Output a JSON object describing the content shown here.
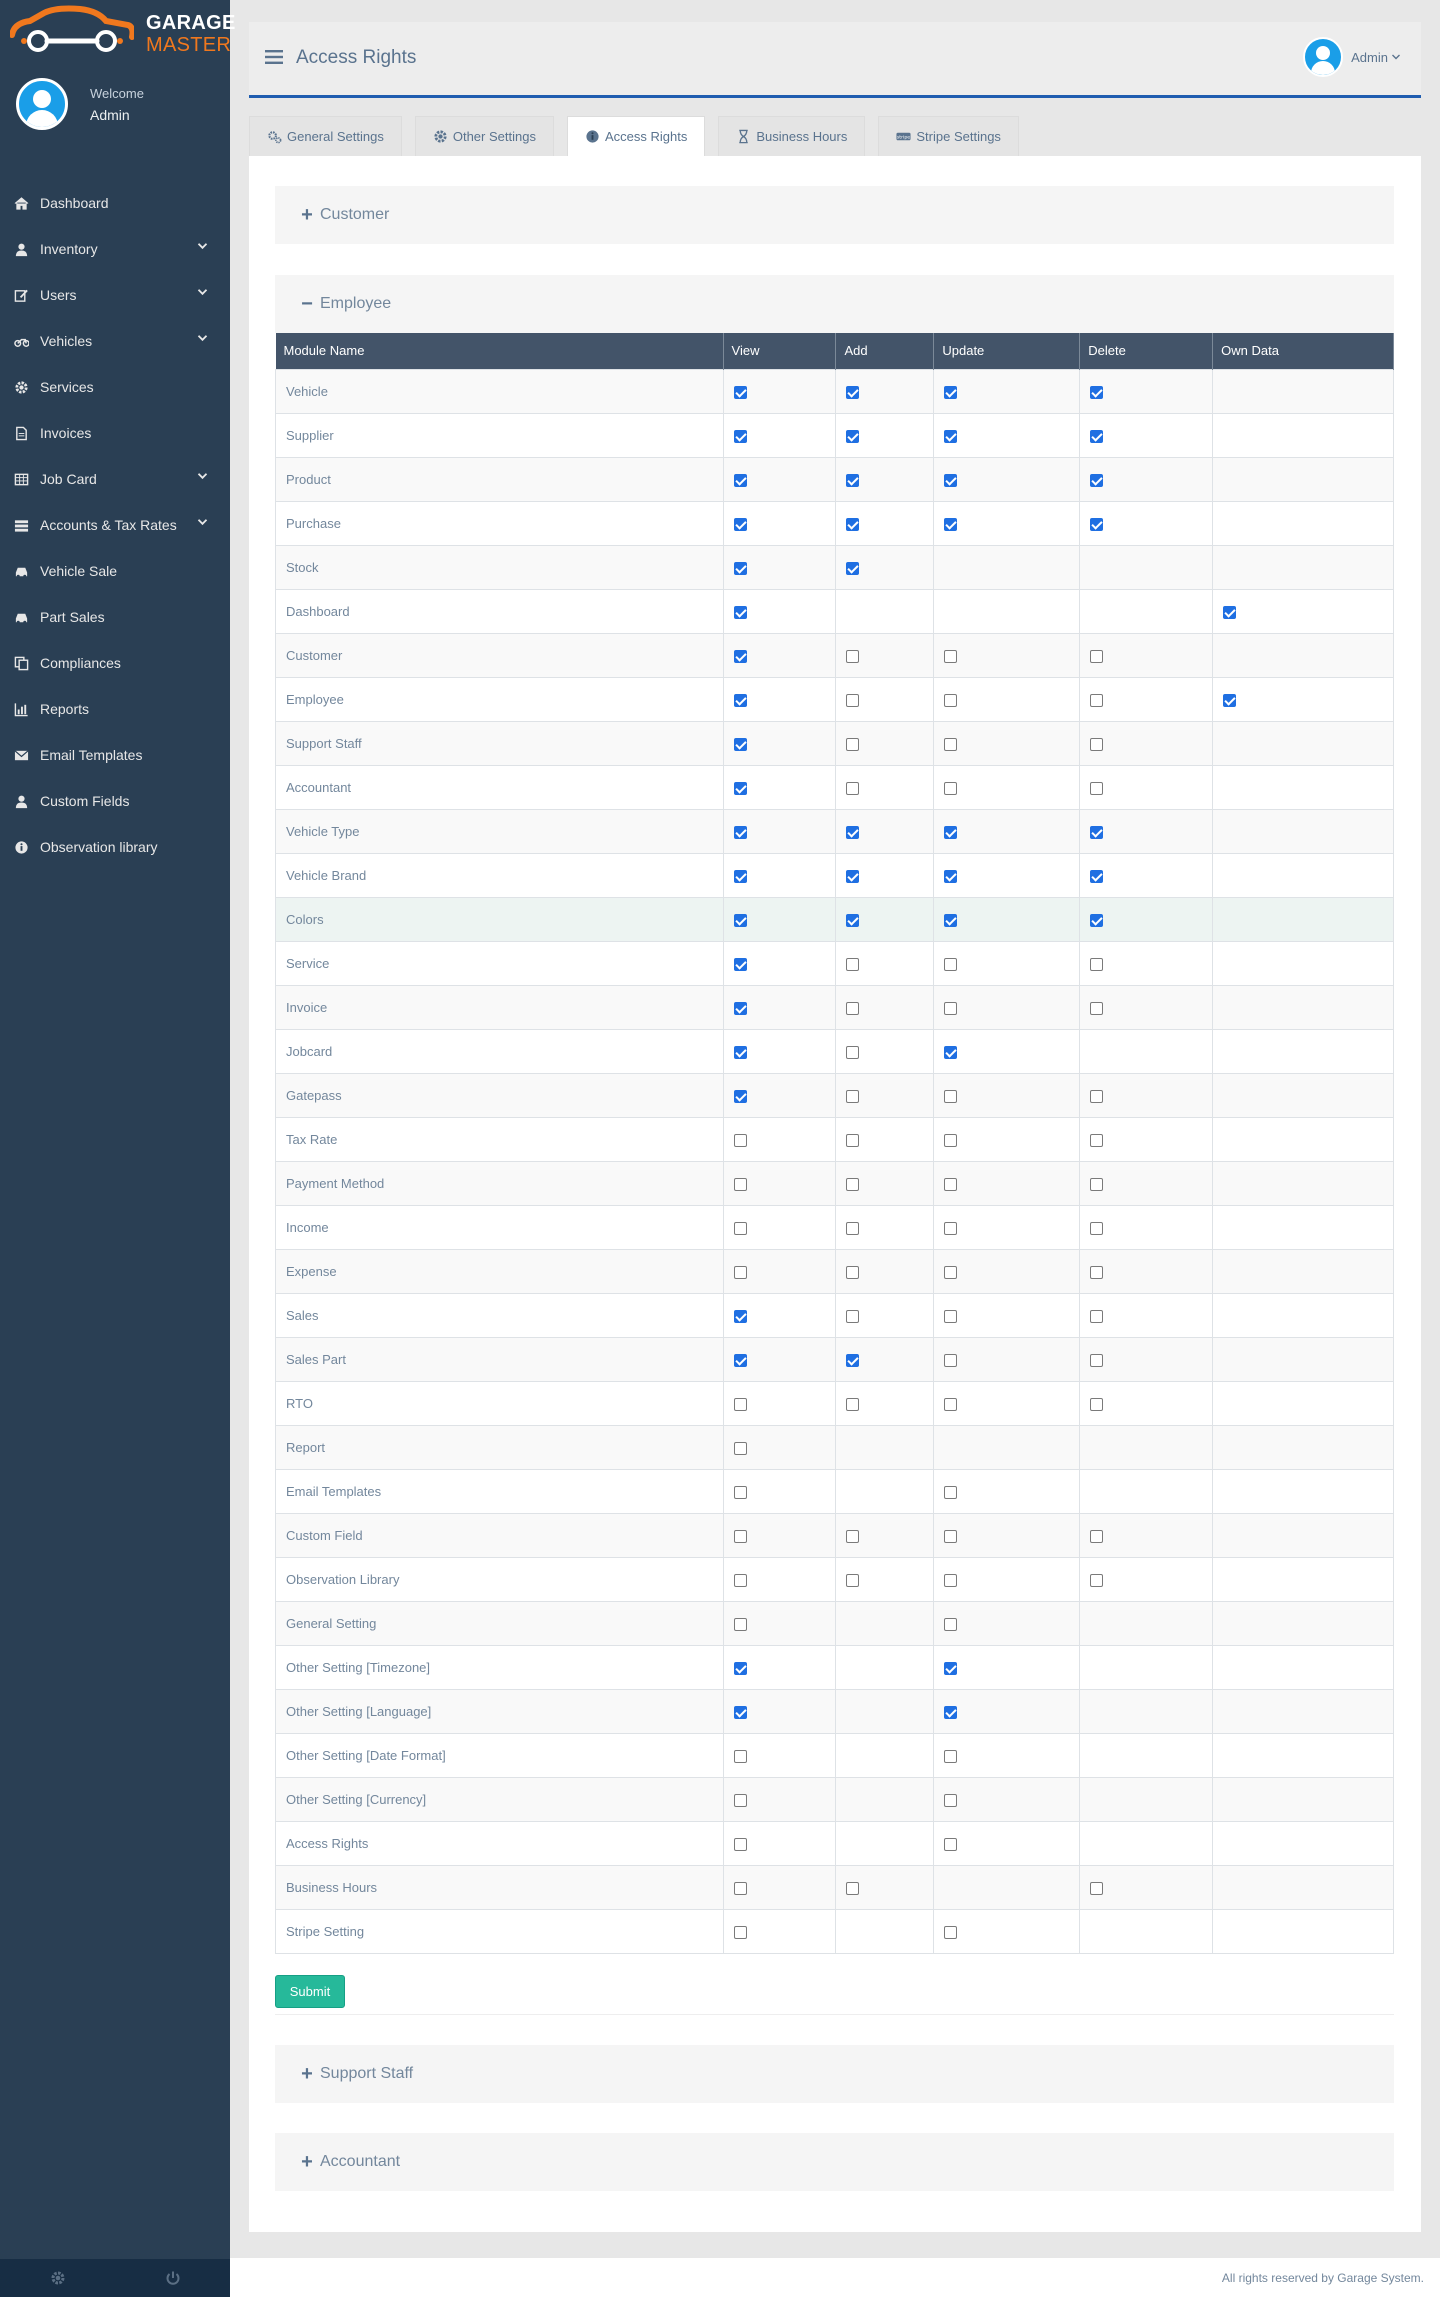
{
  "brand": {
    "line1": "GARAGE",
    "line2": "MASTER"
  },
  "profile": {
    "welcome": "Welcome",
    "name": "Admin"
  },
  "sidebar": {
    "items": [
      {
        "label": "Dashboard",
        "icon": "home-icon",
        "dropdown": false
      },
      {
        "label": "Inventory",
        "icon": "user-icon",
        "dropdown": true
      },
      {
        "label": "Users",
        "icon": "edit-icon",
        "dropdown": true
      },
      {
        "label": "Vehicles",
        "icon": "motorcycle-icon",
        "dropdown": true
      },
      {
        "label": "Services",
        "icon": "gear-icon",
        "dropdown": false
      },
      {
        "label": "Invoices",
        "icon": "file-icon",
        "dropdown": false
      },
      {
        "label": "Job Card",
        "icon": "table-icon",
        "dropdown": true
      },
      {
        "label": "Accounts & Tax Rates",
        "icon": "accounts-icon",
        "dropdown": true
      },
      {
        "label": "Vehicle Sale",
        "icon": "car-icon",
        "dropdown": false
      },
      {
        "label": "Part Sales",
        "icon": "car-icon",
        "dropdown": false
      },
      {
        "label": "Compliances",
        "icon": "copy-icon",
        "dropdown": false
      },
      {
        "label": "Reports",
        "icon": "bar-chart-icon",
        "dropdown": false
      },
      {
        "label": "Email Templates",
        "icon": "envelope-icon",
        "dropdown": false
      },
      {
        "label": "Custom Fields",
        "icon": "user-icon",
        "dropdown": false
      },
      {
        "label": "Observation library",
        "icon": "info-icon",
        "dropdown": false
      }
    ]
  },
  "header": {
    "title": "Access Rights",
    "user": "Admin"
  },
  "tabs": [
    {
      "label": "General Settings",
      "icon": "cogs-icon",
      "active": false
    },
    {
      "label": "Other Settings",
      "icon": "gear-icon",
      "active": false
    },
    {
      "label": "Access Rights",
      "icon": "info-icon",
      "active": true
    },
    {
      "label": "Business Hours",
      "icon": "hourglass-icon",
      "active": false
    },
    {
      "label": "Stripe Settings",
      "icon": "stripe-icon",
      "active": false
    }
  ],
  "sections": {
    "customer": "Customer",
    "employee": "Employee",
    "support_staff": "Support Staff",
    "accountant": "Accountant"
  },
  "table": {
    "columns": [
      "Module Name",
      "View",
      "Add",
      "Update",
      "Delete",
      "Own Data"
    ],
    "rows": [
      {
        "name": "Vehicle",
        "cells": [
          1,
          1,
          1,
          1,
          null
        ]
      },
      {
        "name": "Supplier",
        "cells": [
          1,
          1,
          1,
          1,
          null
        ]
      },
      {
        "name": "Product",
        "cells": [
          1,
          1,
          1,
          1,
          null
        ]
      },
      {
        "name": "Purchase",
        "cells": [
          1,
          1,
          1,
          1,
          null
        ]
      },
      {
        "name": "Stock",
        "cells": [
          1,
          1,
          null,
          null,
          null
        ]
      },
      {
        "name": "Dashboard",
        "cells": [
          1,
          null,
          null,
          null,
          1
        ]
      },
      {
        "name": "Customer",
        "cells": [
          1,
          0,
          0,
          0,
          null
        ]
      },
      {
        "name": "Employee",
        "cells": [
          1,
          0,
          0,
          0,
          1
        ]
      },
      {
        "name": "Support Staff",
        "cells": [
          1,
          0,
          0,
          0,
          null
        ]
      },
      {
        "name": "Accountant",
        "cells": [
          1,
          0,
          0,
          0,
          null
        ]
      },
      {
        "name": "Vehicle Type",
        "cells": [
          1,
          1,
          1,
          1,
          null
        ]
      },
      {
        "name": "Vehicle Brand",
        "cells": [
          1,
          1,
          1,
          1,
          null
        ]
      },
      {
        "name": "Colors",
        "cells": [
          1,
          1,
          1,
          1,
          null
        ],
        "highlight": true
      },
      {
        "name": "Service",
        "cells": [
          1,
          0,
          0,
          0,
          null
        ]
      },
      {
        "name": "Invoice",
        "cells": [
          1,
          0,
          0,
          0,
          null
        ]
      },
      {
        "name": "Jobcard",
        "cells": [
          1,
          0,
          1,
          null,
          null
        ]
      },
      {
        "name": "Gatepass",
        "cells": [
          1,
          0,
          0,
          0,
          null
        ]
      },
      {
        "name": "Tax Rate",
        "cells": [
          0,
          0,
          0,
          0,
          null
        ]
      },
      {
        "name": "Payment Method",
        "cells": [
          0,
          0,
          0,
          0,
          null
        ]
      },
      {
        "name": "Income",
        "cells": [
          0,
          0,
          0,
          0,
          null
        ]
      },
      {
        "name": "Expense",
        "cells": [
          0,
          0,
          0,
          0,
          null
        ]
      },
      {
        "name": "Sales",
        "cells": [
          1,
          0,
          0,
          0,
          null
        ]
      },
      {
        "name": "Sales Part",
        "cells": [
          1,
          1,
          0,
          0,
          null
        ]
      },
      {
        "name": "RTO",
        "cells": [
          0,
          0,
          0,
          0,
          null
        ]
      },
      {
        "name": "Report",
        "cells": [
          0,
          null,
          null,
          null,
          null
        ]
      },
      {
        "name": "Email Templates",
        "cells": [
          0,
          null,
          0,
          null,
          null
        ]
      },
      {
        "name": "Custom Field",
        "cells": [
          0,
          0,
          0,
          0,
          null
        ]
      },
      {
        "name": "Observation Library",
        "cells": [
          0,
          0,
          0,
          0,
          null
        ]
      },
      {
        "name": "General Setting",
        "cells": [
          0,
          null,
          0,
          null,
          null
        ]
      },
      {
        "name": "Other Setting [Timezone]",
        "cells": [
          1,
          null,
          1,
          null,
          null
        ]
      },
      {
        "name": "Other Setting [Language]",
        "cells": [
          1,
          null,
          1,
          null,
          null
        ]
      },
      {
        "name": "Other Setting [Date Format]",
        "cells": [
          0,
          null,
          0,
          null,
          null
        ]
      },
      {
        "name": "Other Setting [Currency]",
        "cells": [
          0,
          null,
          0,
          null,
          null
        ]
      },
      {
        "name": "Access Rights",
        "cells": [
          0,
          null,
          0,
          null,
          null
        ]
      },
      {
        "name": "Business Hours",
        "cells": [
          0,
          0,
          null,
          0,
          null
        ]
      },
      {
        "name": "Stripe Setting",
        "cells": [
          0,
          null,
          0,
          null,
          null
        ]
      }
    ]
  },
  "submit_label": "Submit",
  "footer": "All rights reserved by Garage System.",
  "colors": {
    "sidebar": "#2a3f54",
    "accent": "#1f5db0",
    "brand_orange": "#f0781e",
    "submit": "#26b99a",
    "table_header": "#435469",
    "checkbox": "#1f6fe2"
  }
}
